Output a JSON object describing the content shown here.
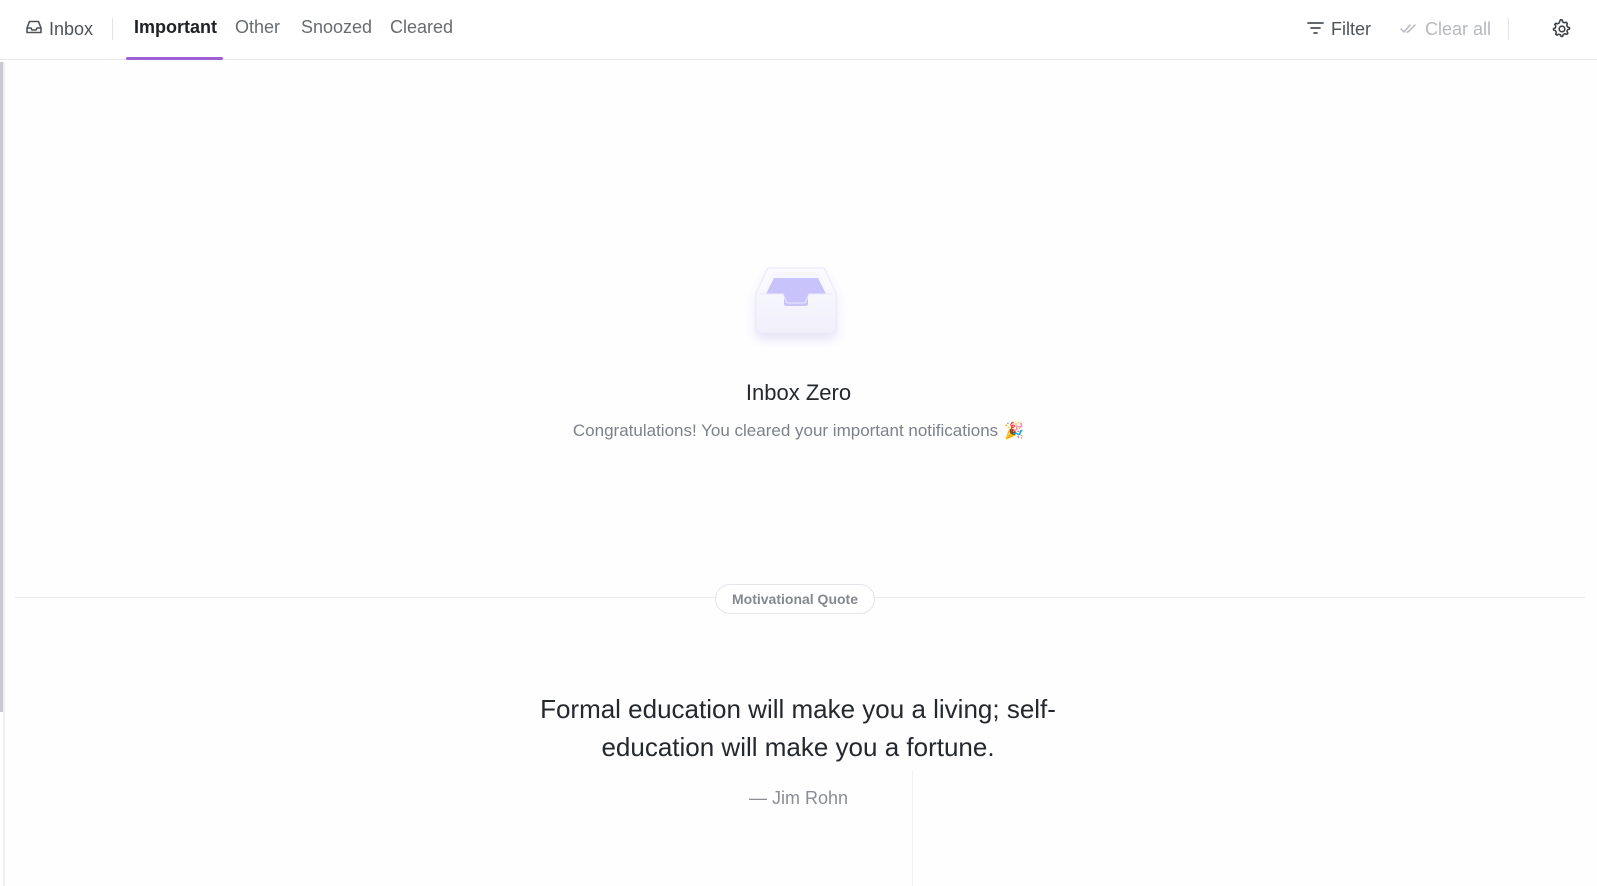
{
  "header": {
    "inbox_label": "Inbox",
    "tabs": [
      {
        "label": "Important",
        "active": true
      },
      {
        "label": "Other",
        "active": false
      },
      {
        "label": "Snoozed",
        "active": false
      },
      {
        "label": "Cleared",
        "active": false
      }
    ],
    "filter_label": "Filter",
    "clear_all_label": "Clear all",
    "icons": {
      "inbox": "inbox-tray-icon",
      "filter": "filter-icon",
      "clear_all": "double-check-icon",
      "settings": "gear-icon"
    }
  },
  "empty_state": {
    "title": "Inbox Zero",
    "subtitle": "Congratulations! You cleared your important notifications",
    "emoji": "🎉",
    "illustration": "inbox-tray-illustration"
  },
  "quote": {
    "badge": "Motivational Quote",
    "text": "Formal education will make you a living; self-education will make you a fortune.",
    "author": "— Jim Rohn"
  },
  "colors": {
    "accent": "#9d5fd2",
    "illustration_purple": "#c9c3fb"
  }
}
